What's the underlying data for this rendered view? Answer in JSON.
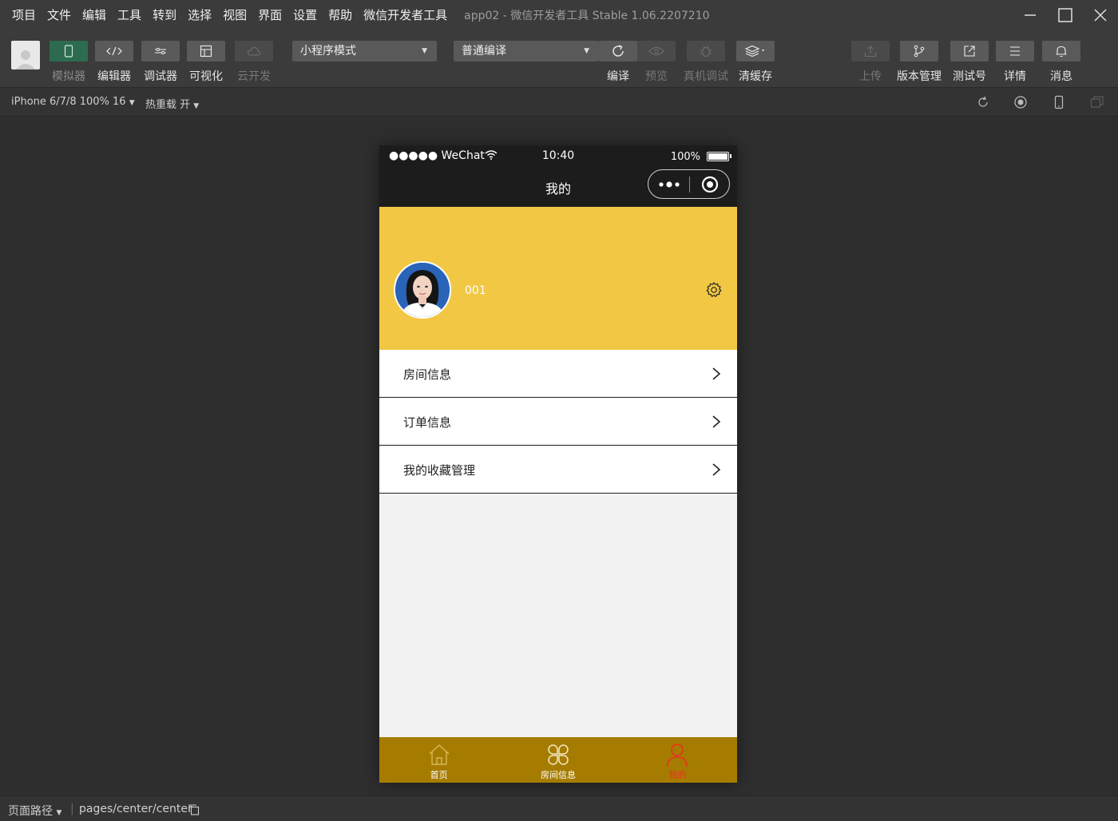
{
  "menu": {
    "items": [
      "项目",
      "文件",
      "编辑",
      "工具",
      "转到",
      "选择",
      "视图",
      "界面",
      "设置",
      "帮助",
      "微信开发者工具"
    ],
    "app_title": "app02 - 微信开发者工具 Stable 1.06.2207210"
  },
  "toolbar": {
    "left_tools": [
      {
        "label": "模拟器",
        "icon": "phone-icon",
        "state": "active"
      },
      {
        "label": "编辑器",
        "icon": "code-icon",
        "state": "normal"
      },
      {
        "label": "调试器",
        "icon": "debug-icon",
        "state": "normal"
      },
      {
        "label": "可视化",
        "icon": "layout-icon",
        "state": "normal"
      },
      {
        "label": "云开发",
        "icon": "cloud-icon",
        "state": "disabled"
      }
    ],
    "mode_select": "小程序模式",
    "compile_select": "普通编译",
    "center_tools": [
      {
        "label": "编译",
        "icon": "refresh-icon",
        "state": "normal"
      },
      {
        "label": "预览",
        "icon": "eye-icon",
        "state": "disabled"
      },
      {
        "label": "真机调试",
        "icon": "bug-icon",
        "state": "disabled"
      },
      {
        "label": "清缓存",
        "icon": "layers-icon",
        "state": "normal"
      }
    ],
    "right_tools": [
      {
        "label": "上传",
        "icon": "upload-icon",
        "state": "disabled"
      },
      {
        "label": "版本管理",
        "icon": "branch-icon",
        "state": "normal"
      },
      {
        "label": "测试号",
        "icon": "external-link-icon",
        "state": "normal"
      },
      {
        "label": "详情",
        "icon": "menu-icon",
        "state": "normal"
      },
      {
        "label": "消息",
        "icon": "bell-icon",
        "state": "normal"
      }
    ]
  },
  "subbar": {
    "device": "iPhone 6/7/8 100% 16",
    "hot_reload": "热重载 开"
  },
  "phone": {
    "status": {
      "carrier": "●●●●● WeChat",
      "time": "10:40",
      "battery": "100%"
    },
    "nav_title": "我的",
    "username": "001",
    "list": [
      {
        "label": "房间信息"
      },
      {
        "label": "订单信息"
      },
      {
        "label": "我的收藏管理"
      }
    ],
    "tabs": [
      {
        "label": "首页",
        "icon": "home-icon"
      },
      {
        "label": "房间信息",
        "icon": "clover-icon"
      },
      {
        "label": "我的",
        "icon": "user-icon"
      }
    ],
    "colors": {
      "header": "#f1c744",
      "tabbar": "#a67c00",
      "tab_active": "#e2381b"
    }
  },
  "bottombar": {
    "path_label": "页面路径",
    "path": "pages/center/center"
  }
}
